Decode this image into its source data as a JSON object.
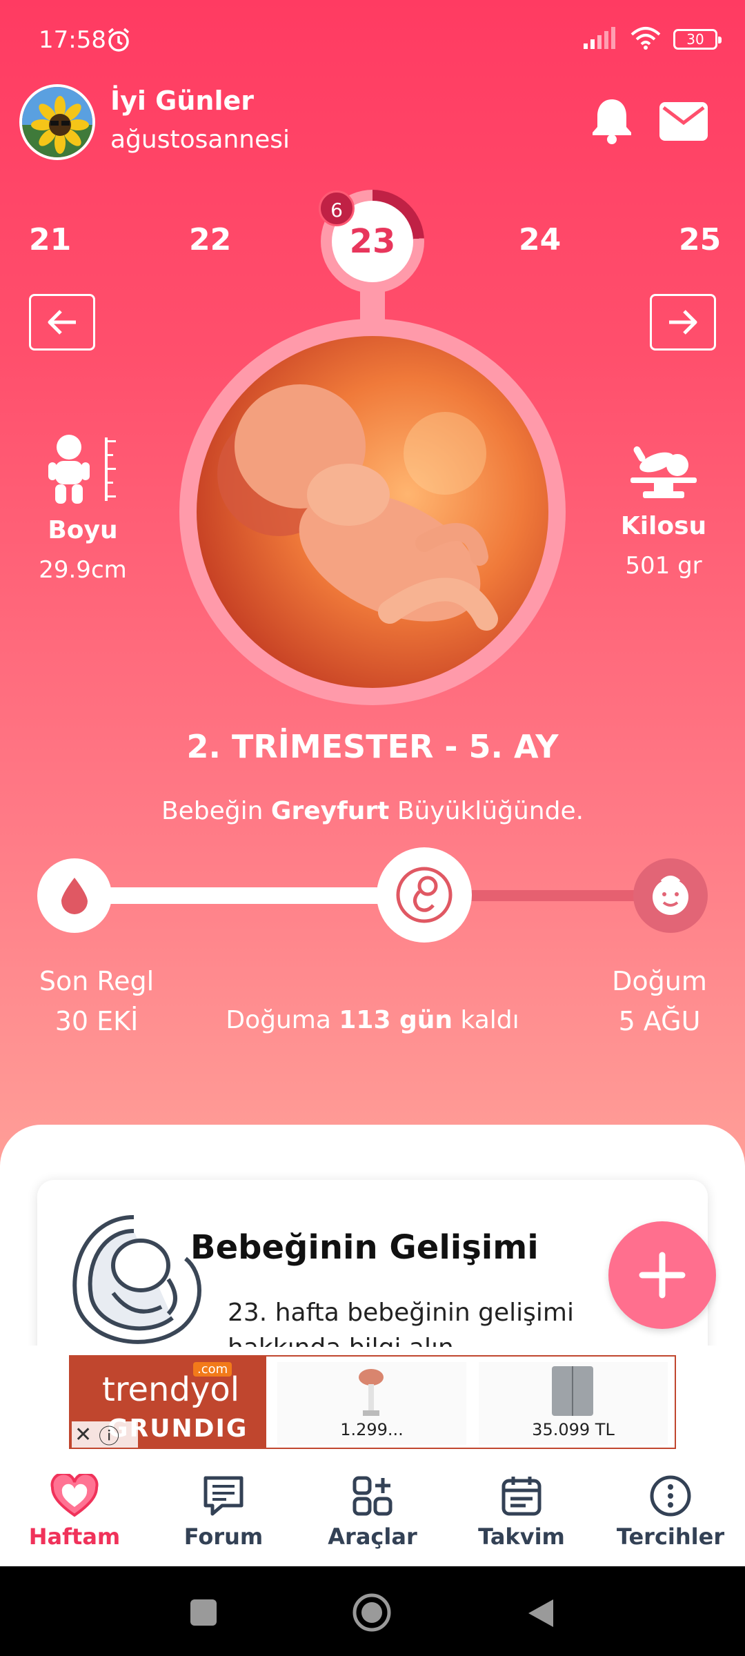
{
  "status": {
    "time": "17:58",
    "battery": "30"
  },
  "header": {
    "greeting": "İyi Günler",
    "username": "ağustosannesi"
  },
  "weeks": {
    "items": [
      "21",
      "22",
      "23",
      "24",
      "25"
    ],
    "current": "23",
    "badge": "6"
  },
  "metrics": {
    "height_label": "Boyu",
    "height_value": "29.9cm",
    "weight_label": "Kilosu",
    "weight_value": "501 gr"
  },
  "trimester": "2. TRİMESTER - 5. AY",
  "size": {
    "prefix": "Bebeğin ",
    "fruit": "Greyfurt",
    "suffix": " Büyüklüğünde."
  },
  "progress": {
    "fraction": 0.6,
    "start_label": "Son Regl",
    "start_date": "30 EKİ",
    "end_label": "Doğum",
    "end_date": "5 AĞU",
    "remaining_prefix": "Doğuma ",
    "remaining_value": "113 gün",
    "remaining_suffix": " kaldı"
  },
  "card": {
    "title": "Bebeğinin Gelişimi",
    "text_line1": "23. hafta bebeğinin gelişimi",
    "text_line2": "hakkında bilgi alın"
  },
  "ad": {
    "brand": "trendyol",
    "brand_com": ".com",
    "brand2": "GRUNDIG",
    "price1": "1.299...",
    "price2": "35.099 TL"
  },
  "nav": {
    "items": [
      "Haftam",
      "Forum",
      "Araçlar",
      "Takvim",
      "Tercihler"
    ]
  },
  "colors": {
    "accent": "#f0325a",
    "hero_top": "#ff3b62",
    "hero_bottom": "#ff9f98",
    "nav_text": "#334155"
  }
}
